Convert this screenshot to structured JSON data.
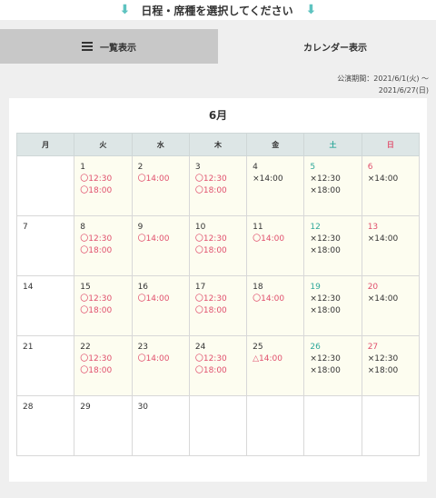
{
  "hint": {
    "text": "日程・席種を選択してください"
  },
  "tabs": [
    {
      "label": "一覧表示",
      "icon": "list-icon",
      "active": false
    },
    {
      "label": "カレンダー表示",
      "icon": "calendar-grid-icon",
      "active": true
    }
  ],
  "period": {
    "line1": "公演期間：2021/6/1(火) 〜",
    "line2": "2021/6/27(日)"
  },
  "calendar": {
    "month": "6月",
    "weekdays": [
      "月",
      "火",
      "水",
      "木",
      "金",
      "土",
      "日"
    ],
    "weeks": [
      [
        {
          "day": "",
          "slots": []
        },
        {
          "day": "1",
          "slots": [
            "〇12:30",
            "〇18:00"
          ]
        },
        {
          "day": "2",
          "slots": [
            "〇14:00"
          ]
        },
        {
          "day": "3",
          "slots": [
            "〇12:30",
            "〇18:00"
          ]
        },
        {
          "day": "4",
          "slots": [
            "×14:00"
          ]
        },
        {
          "day": "5",
          "slots": [
            "×12:30",
            "×18:00"
          ]
        },
        {
          "day": "6",
          "slots": [
            "×14:00"
          ]
        }
      ],
      [
        {
          "day": "7",
          "slots": []
        },
        {
          "day": "8",
          "slots": [
            "〇12:30",
            "〇18:00"
          ]
        },
        {
          "day": "9",
          "slots": [
            "〇14:00"
          ]
        },
        {
          "day": "10",
          "slots": [
            "〇12:30",
            "〇18:00"
          ]
        },
        {
          "day": "11",
          "slots": [
            "〇14:00"
          ]
        },
        {
          "day": "12",
          "slots": [
            "×12:30",
            "×18:00"
          ]
        },
        {
          "day": "13",
          "slots": [
            "×14:00"
          ]
        }
      ],
      [
        {
          "day": "14",
          "slots": []
        },
        {
          "day": "15",
          "slots": [
            "〇12:30",
            "〇18:00"
          ]
        },
        {
          "day": "16",
          "slots": [
            "〇14:00"
          ]
        },
        {
          "day": "17",
          "slots": [
            "〇12:30",
            "〇18:00"
          ]
        },
        {
          "day": "18",
          "slots": [
            "〇14:00"
          ]
        },
        {
          "day": "19",
          "slots": [
            "×12:30",
            "×18:00"
          ]
        },
        {
          "day": "20",
          "slots": [
            "×14:00"
          ]
        }
      ],
      [
        {
          "day": "21",
          "slots": []
        },
        {
          "day": "22",
          "slots": [
            "〇12:30",
            "〇18:00"
          ]
        },
        {
          "day": "23",
          "slots": [
            "〇14:00"
          ]
        },
        {
          "day": "24",
          "slots": [
            "〇12:30",
            "〇18:00"
          ]
        },
        {
          "day": "25",
          "slots": [
            "△14:00"
          ]
        },
        {
          "day": "26",
          "slots": [
            "×12:30",
            "×18:00"
          ]
        },
        {
          "day": "27",
          "slots": [
            "×12:30",
            "×18:00"
          ]
        }
      ],
      [
        {
          "day": "28",
          "slots": []
        },
        {
          "day": "29",
          "slots": []
        },
        {
          "day": "30",
          "slots": []
        },
        {
          "day": "",
          "slots": []
        },
        {
          "day": "",
          "slots": []
        },
        {
          "day": "",
          "slots": []
        },
        {
          "day": "",
          "slots": []
        }
      ]
    ]
  },
  "colors": {
    "accent": "#5ec3c0",
    "saturday": "#2fa89a",
    "sunday": "#e0506d",
    "available": "#e0506d",
    "soldout": "#333333"
  }
}
